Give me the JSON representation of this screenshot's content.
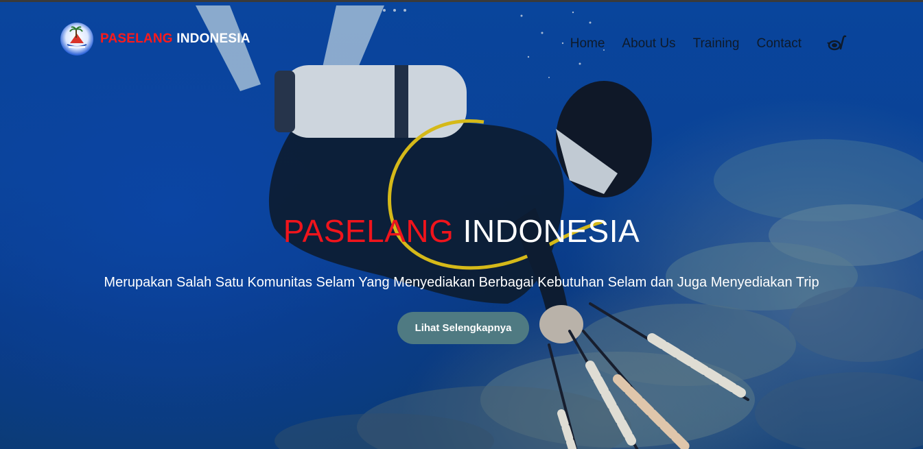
{
  "brand": {
    "logo_icon": "paselang-logo-icon",
    "name_part1": "PASELANG",
    "name_part2": "INDONESIA",
    "color_part1": "#ff1a1a",
    "color_part2": "#ffffff"
  },
  "nav": {
    "items": [
      {
        "label": "Home"
      },
      {
        "label": "About Us"
      },
      {
        "label": "Training"
      },
      {
        "label": "Contact"
      }
    ],
    "icon": "diving-mask-snorkel-icon"
  },
  "hero": {
    "title_part1": "PASELANG",
    "title_part2": "INDONESIA",
    "subtitle": "Merupakan Salah Satu Komunitas Selam Yang Menyediakan Berbagai Kebutuhan Selam dan Juga Menyediakan Trip",
    "button_label": "Lihat Selengkapnya",
    "button_color": "#4f7a82",
    "background_image": "scuba-diver-coral-reef"
  }
}
